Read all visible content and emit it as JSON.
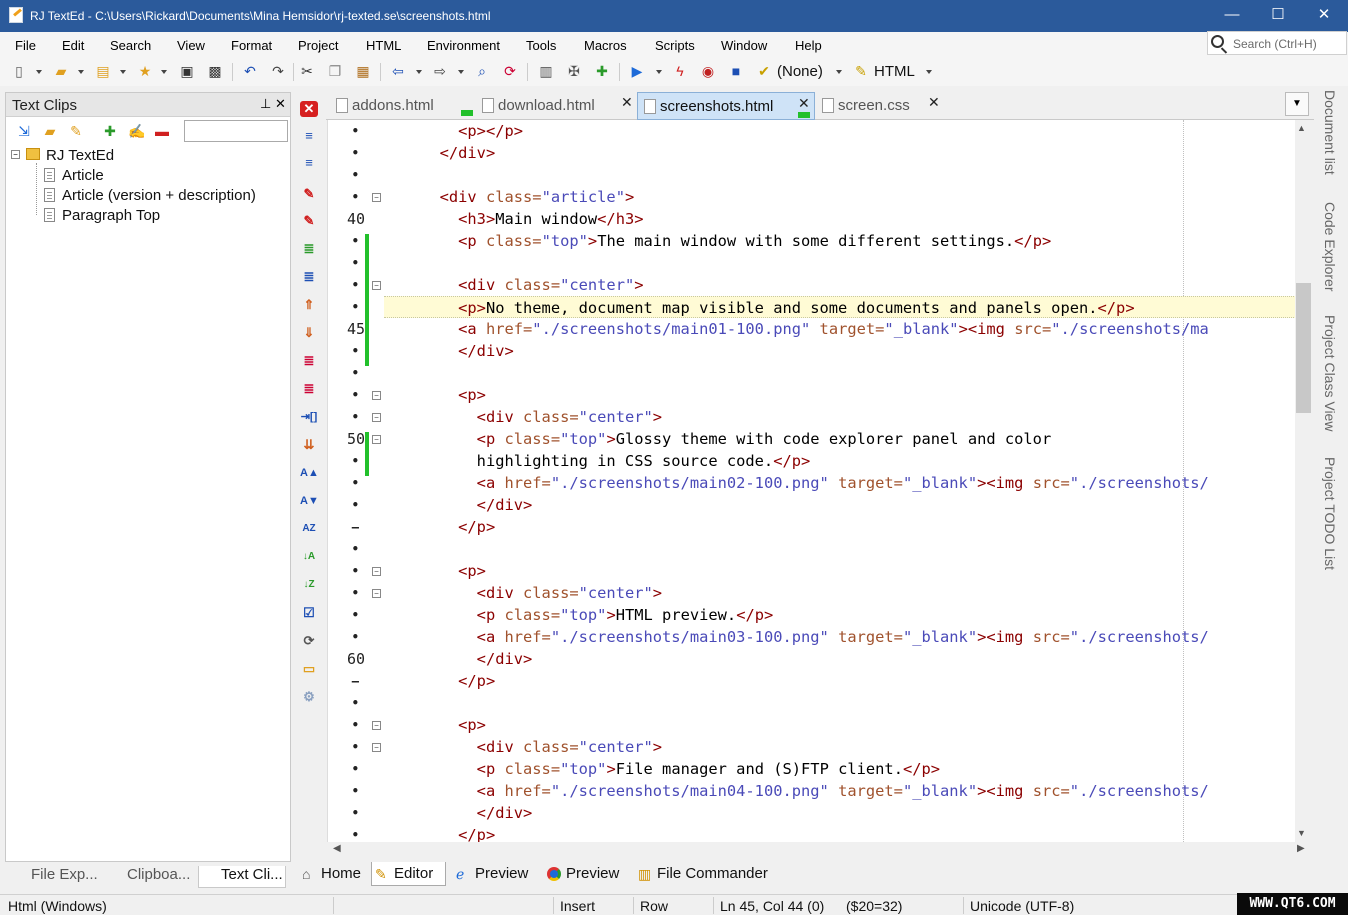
{
  "window": {
    "title": "RJ TextEd - C:\\Users\\Rickard\\Documents\\Mina Hemsidor\\rj-texted.se\\screenshots.html",
    "minimize": "—",
    "maximize": "☐",
    "close": "✕"
  },
  "menu": [
    "File",
    "Edit",
    "Search",
    "View",
    "Format",
    "Project",
    "HTML",
    "Environment",
    "Tools",
    "Macros",
    "Scripts",
    "Window",
    "Help"
  ],
  "search": {
    "placeholder": "Search (Ctrl+H)"
  },
  "toolbar": {
    "run_target": "(None)",
    "syntax": "HTML"
  },
  "left_panel": {
    "title": "Text Clips",
    "root": "RJ TextEd",
    "items": [
      "Article",
      "Article (version + description)",
      "Paragraph Top"
    ],
    "tabs": [
      "File Exp...",
      "Clipboa...",
      "Text Cli..."
    ]
  },
  "file_tabs": [
    {
      "label": "addons.html",
      "active": false
    },
    {
      "label": "download.html",
      "active": false
    },
    {
      "label": "screenshots.html",
      "active": true
    },
    {
      "label": "screen.css",
      "active": false
    }
  ],
  "editor": {
    "line_numbers": {
      "40": "40",
      "45": "45",
      "50": "50",
      "60": "60"
    },
    "lines": [
      {
        "indent": "        ",
        "parts": [
          [
            "tag",
            "<p></p>"
          ]
        ]
      },
      {
        "indent": "      ",
        "parts": [
          [
            "tag",
            "</div>"
          ]
        ]
      },
      {
        "indent": "",
        "parts": []
      },
      {
        "indent": "      ",
        "parts": [
          [
            "tag",
            "<div "
          ],
          [
            "attr",
            "class="
          ],
          [
            "val",
            "\"article\""
          ],
          [
            "tag",
            ">"
          ]
        ]
      },
      {
        "indent": "        ",
        "parts": [
          [
            "tag",
            "<h3>"
          ],
          [
            "text",
            "Main window"
          ],
          [
            "tag",
            "</h3>"
          ]
        ]
      },
      {
        "indent": "        ",
        "parts": [
          [
            "tag",
            "<p "
          ],
          [
            "attr",
            "class="
          ],
          [
            "val",
            "\"top\""
          ],
          [
            "tag",
            ">"
          ],
          [
            "text",
            "The main window with some different settings."
          ],
          [
            "tag",
            "</p>"
          ]
        ]
      },
      {
        "indent": "",
        "parts": []
      },
      {
        "indent": "        ",
        "parts": [
          [
            "tag",
            "<div "
          ],
          [
            "attr",
            "class="
          ],
          [
            "val",
            "\"center\""
          ],
          [
            "tag",
            ">"
          ]
        ]
      },
      {
        "indent": "        ",
        "parts": [
          [
            "tag",
            "<p>"
          ],
          [
            "text",
            "No theme, document map visible and some documents and panels open."
          ],
          [
            "tag",
            "</p>"
          ]
        ]
      },
      {
        "indent": "        ",
        "parts": [
          [
            "tag",
            "<a "
          ],
          [
            "attr",
            "href="
          ],
          [
            "val",
            "\"./screenshots/main01-100.png\""
          ],
          [
            "attr",
            " target="
          ],
          [
            "val",
            "\"_blank\""
          ],
          [
            "tag",
            ">"
          ],
          [
            "tag",
            "<img "
          ],
          [
            "attr",
            "src="
          ],
          [
            "val",
            "\"./screenshots/ma"
          ]
        ]
      },
      {
        "indent": "        ",
        "parts": [
          [
            "tag",
            "</div>"
          ]
        ]
      },
      {
        "indent": "",
        "parts": []
      },
      {
        "indent": "        ",
        "parts": [
          [
            "tag",
            "<p>"
          ]
        ]
      },
      {
        "indent": "          ",
        "parts": [
          [
            "tag",
            "<div "
          ],
          [
            "attr",
            "class="
          ],
          [
            "val",
            "\"center\""
          ],
          [
            "tag",
            ">"
          ]
        ]
      },
      {
        "indent": "          ",
        "parts": [
          [
            "tag",
            "<p "
          ],
          [
            "attr",
            "class="
          ],
          [
            "val",
            "\"top\""
          ],
          [
            "tag",
            ">"
          ],
          [
            "text",
            "Glossy theme with code explorer panel and color"
          ]
        ]
      },
      {
        "indent": "          ",
        "parts": [
          [
            "text",
            "highlighting in CSS source code."
          ],
          [
            "tag",
            "</p>"
          ]
        ]
      },
      {
        "indent": "          ",
        "parts": [
          [
            "tag",
            "<a "
          ],
          [
            "attr",
            "href="
          ],
          [
            "val",
            "\"./screenshots/main02-100.png\""
          ],
          [
            "attr",
            " target="
          ],
          [
            "val",
            "\"_blank\""
          ],
          [
            "tag",
            ">"
          ],
          [
            "tag",
            "<img "
          ],
          [
            "attr",
            "src="
          ],
          [
            "val",
            "\"./screenshots/"
          ]
        ]
      },
      {
        "indent": "          ",
        "parts": [
          [
            "tag",
            "</div>"
          ]
        ]
      },
      {
        "indent": "        ",
        "parts": [
          [
            "tag",
            "</p>"
          ]
        ]
      },
      {
        "indent": "",
        "parts": []
      },
      {
        "indent": "        ",
        "parts": [
          [
            "tag",
            "<p>"
          ]
        ]
      },
      {
        "indent": "          ",
        "parts": [
          [
            "tag",
            "<div "
          ],
          [
            "attr",
            "class="
          ],
          [
            "val",
            "\"center\""
          ],
          [
            "tag",
            ">"
          ]
        ]
      },
      {
        "indent": "          ",
        "parts": [
          [
            "tag",
            "<p "
          ],
          [
            "attr",
            "class="
          ],
          [
            "val",
            "\"top\""
          ],
          [
            "tag",
            ">"
          ],
          [
            "text",
            "HTML preview."
          ],
          [
            "tag",
            "</p>"
          ]
        ]
      },
      {
        "indent": "          ",
        "parts": [
          [
            "tag",
            "<a "
          ],
          [
            "attr",
            "href="
          ],
          [
            "val",
            "\"./screenshots/main03-100.png\""
          ],
          [
            "attr",
            " target="
          ],
          [
            "val",
            "\"_blank\""
          ],
          [
            "tag",
            ">"
          ],
          [
            "tag",
            "<img "
          ],
          [
            "attr",
            "src="
          ],
          [
            "val",
            "\"./screenshots/"
          ]
        ]
      },
      {
        "indent": "          ",
        "parts": [
          [
            "tag",
            "</div>"
          ]
        ]
      },
      {
        "indent": "        ",
        "parts": [
          [
            "tag",
            "</p>"
          ]
        ]
      },
      {
        "indent": "",
        "parts": []
      },
      {
        "indent": "        ",
        "parts": [
          [
            "tag",
            "<p>"
          ]
        ]
      },
      {
        "indent": "          ",
        "parts": [
          [
            "tag",
            "<div "
          ],
          [
            "attr",
            "class="
          ],
          [
            "val",
            "\"center\""
          ],
          [
            "tag",
            ">"
          ]
        ]
      },
      {
        "indent": "          ",
        "parts": [
          [
            "tag",
            "<p "
          ],
          [
            "attr",
            "class="
          ],
          [
            "val",
            "\"top\""
          ],
          [
            "tag",
            ">"
          ],
          [
            "text",
            "File manager and (S)FTP client."
          ],
          [
            "tag",
            "</p>"
          ]
        ]
      },
      {
        "indent": "          ",
        "parts": [
          [
            "tag",
            "<a "
          ],
          [
            "attr",
            "href="
          ],
          [
            "val",
            "\"./screenshots/main04-100.png\""
          ],
          [
            "attr",
            " target="
          ],
          [
            "val",
            "\"_blank\""
          ],
          [
            "tag",
            ">"
          ],
          [
            "tag",
            "<img "
          ],
          [
            "attr",
            "src="
          ],
          [
            "val",
            "\"./screenshots/"
          ]
        ]
      },
      {
        "indent": "          ",
        "parts": [
          [
            "tag",
            "</div>"
          ]
        ]
      },
      {
        "indent": "        ",
        "parts": [
          [
            "tag",
            "</p>"
          ]
        ]
      }
    ],
    "current_line_index": 8
  },
  "side_tabs": [
    "Document list",
    "Code Explorer",
    "Project Class View",
    "Project TODO List"
  ],
  "view_tabs": [
    "Home",
    "Editor",
    "Preview",
    "Preview",
    "File Commander"
  ],
  "status": {
    "mode": "Html (Windows)",
    "insert": "Insert",
    "row": "Row",
    "position": "Ln 45, Col 44 (0)",
    "char": "($20=32)",
    "encoding": "Unicode (UTF-8)"
  },
  "watermark": "WWW.QT6.COM",
  "colors": {
    "titlebar": "#2b5a9b",
    "tag": "#8b0000",
    "attribute": "#a0522d",
    "value": "#4a4ab8",
    "current_line": "#fffbd5",
    "change_marker": "#22c02b"
  }
}
